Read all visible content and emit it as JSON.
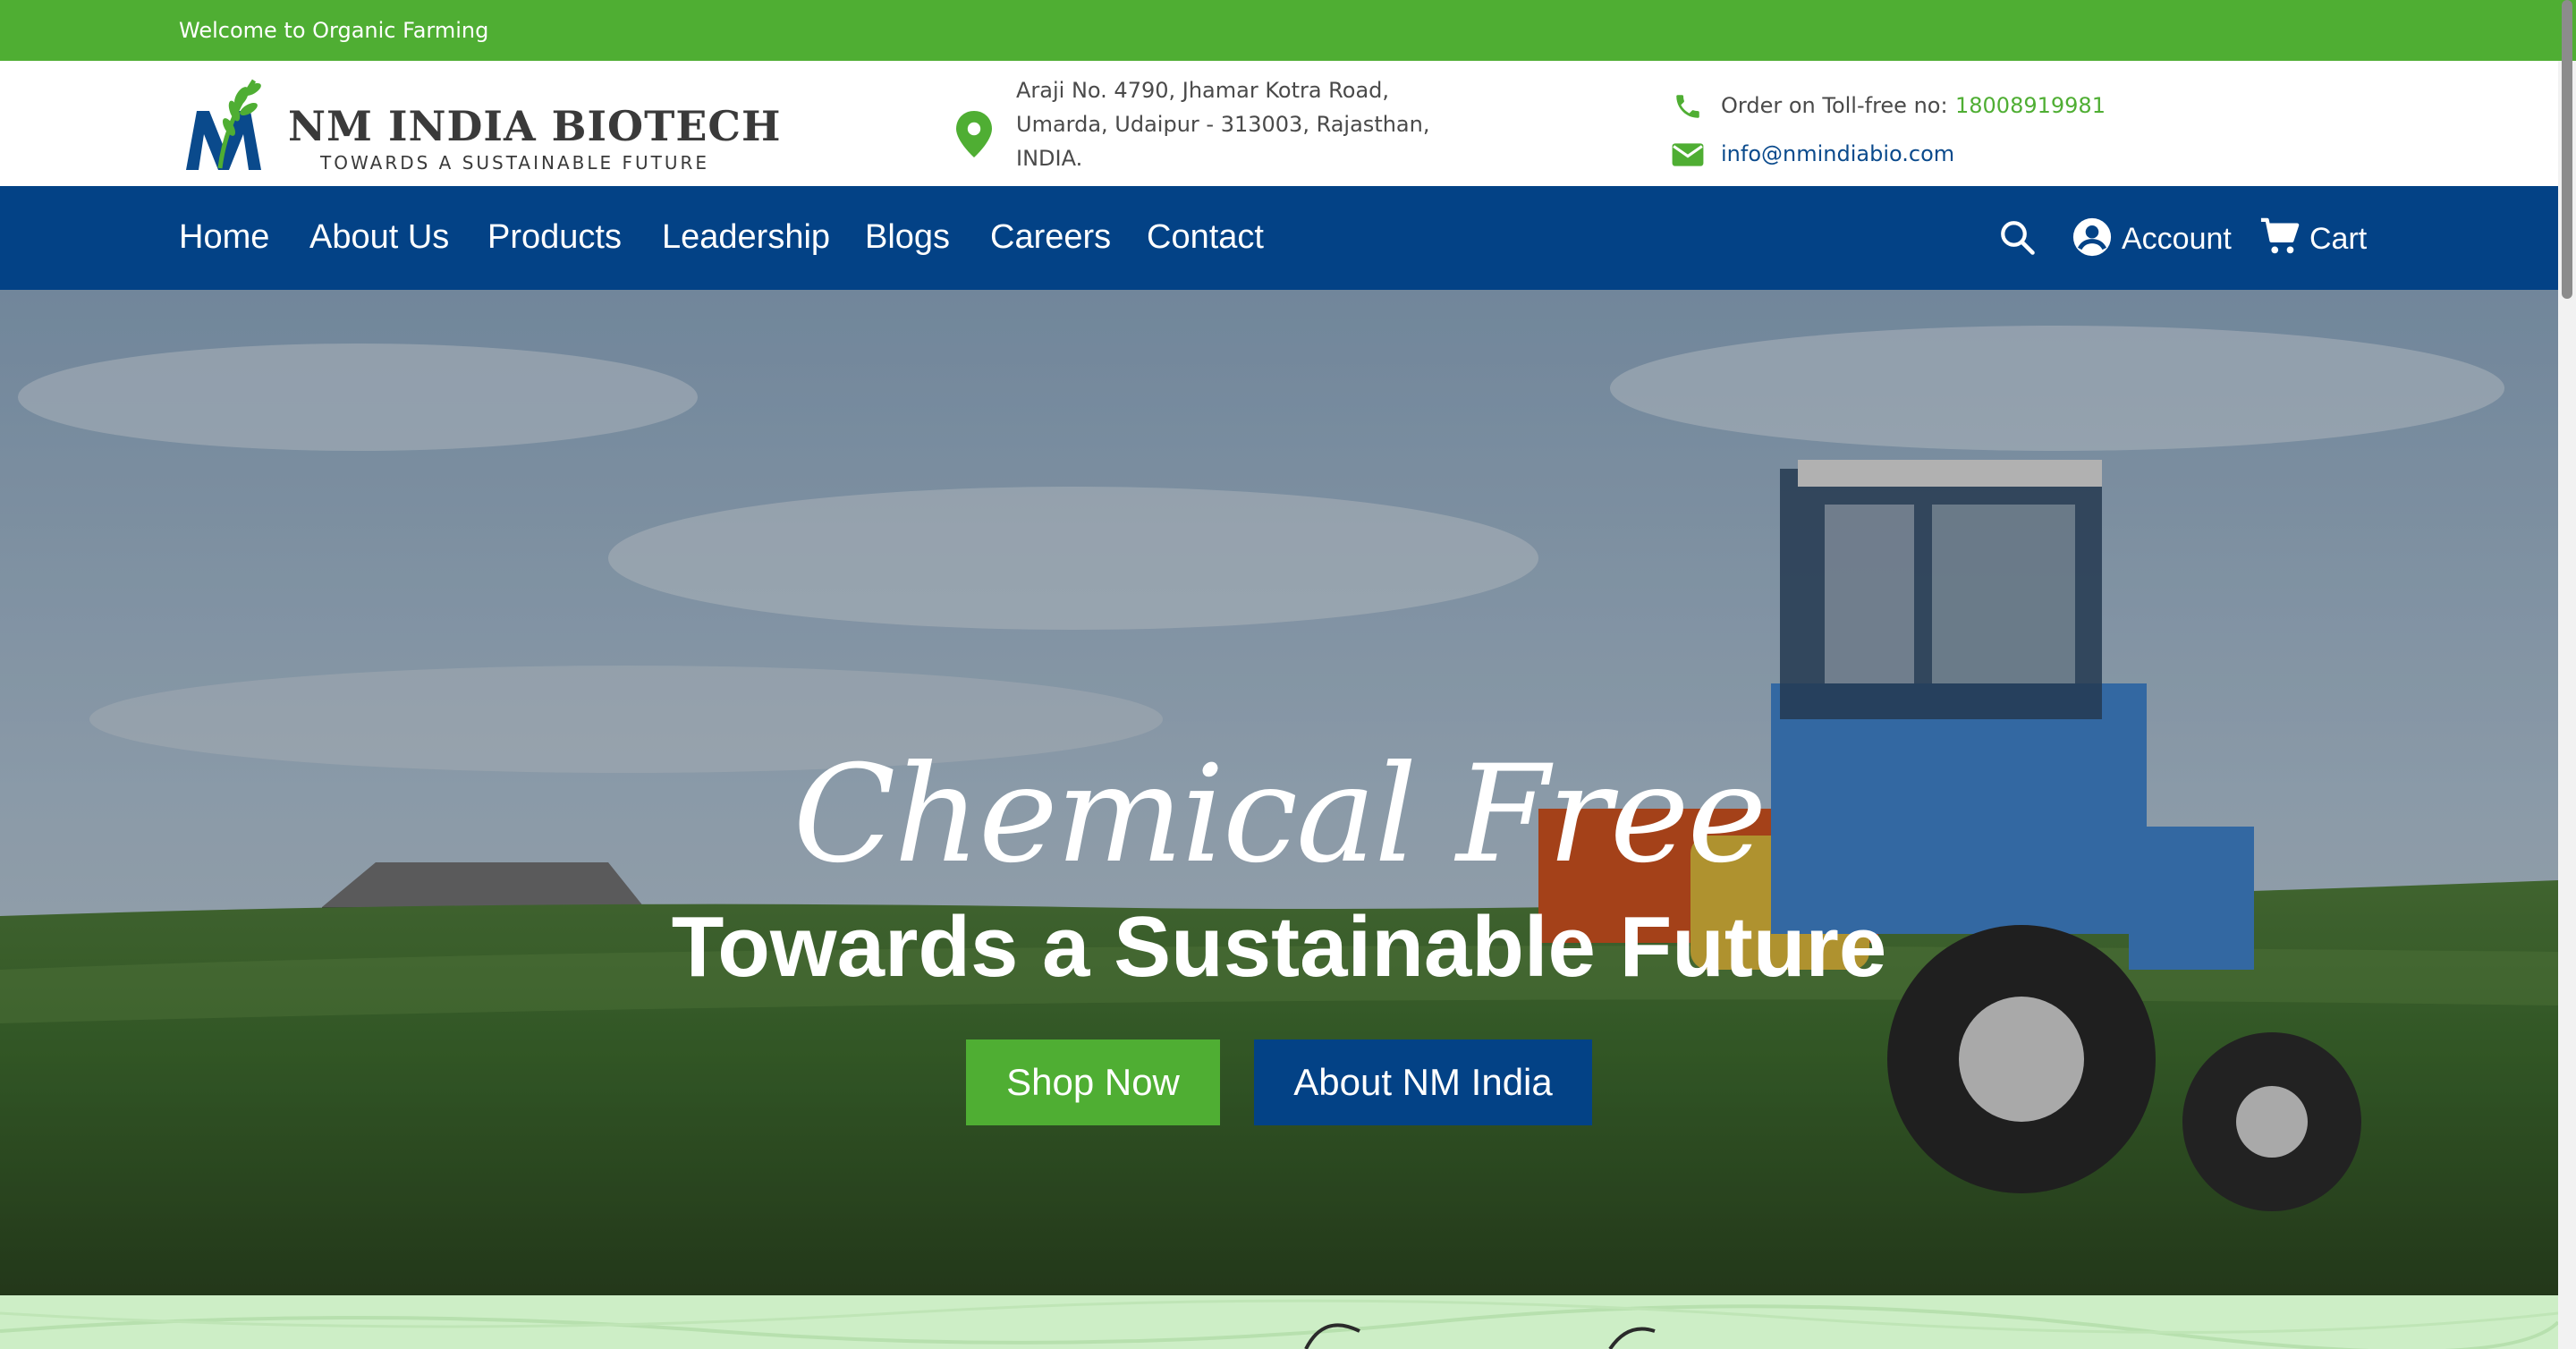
{
  "topbar": {
    "welcome": "Welcome to Organic Farming"
  },
  "brand": {
    "name": "NM INDIA BIOTECH",
    "tagline": "TOWARDS A SUSTAINABLE FUTURE"
  },
  "address": {
    "line1": "Araji No. 4790, Jhamar Kotra Road,",
    "line2": "Umarda, Udaipur - 313003, Rajasthan,",
    "line3": "INDIA."
  },
  "contact": {
    "order_label": "Order on Toll-free no:",
    "phone": "18008919981",
    "email": "info@nmindiabio.com"
  },
  "nav": {
    "items": [
      {
        "label": "Home"
      },
      {
        "label": "About Us"
      },
      {
        "label": "Products"
      },
      {
        "label": "Leadership"
      },
      {
        "label": "Blogs"
      },
      {
        "label": "Careers"
      },
      {
        "label": "Contact"
      }
    ],
    "account_label": "Account",
    "cart_label": "Cart"
  },
  "hero": {
    "script_text": "Chemical Free",
    "headline": "Towards a Sustainable Future",
    "shop_button": "Shop Now",
    "about_button": "About NM India"
  },
  "colors": {
    "green": "#4fae33",
    "navy": "#034286",
    "strip": "#cdeec6"
  },
  "icons": [
    "location-pin-icon",
    "phone-icon",
    "mail-icon",
    "search-icon",
    "account-icon",
    "cart-icon"
  ]
}
